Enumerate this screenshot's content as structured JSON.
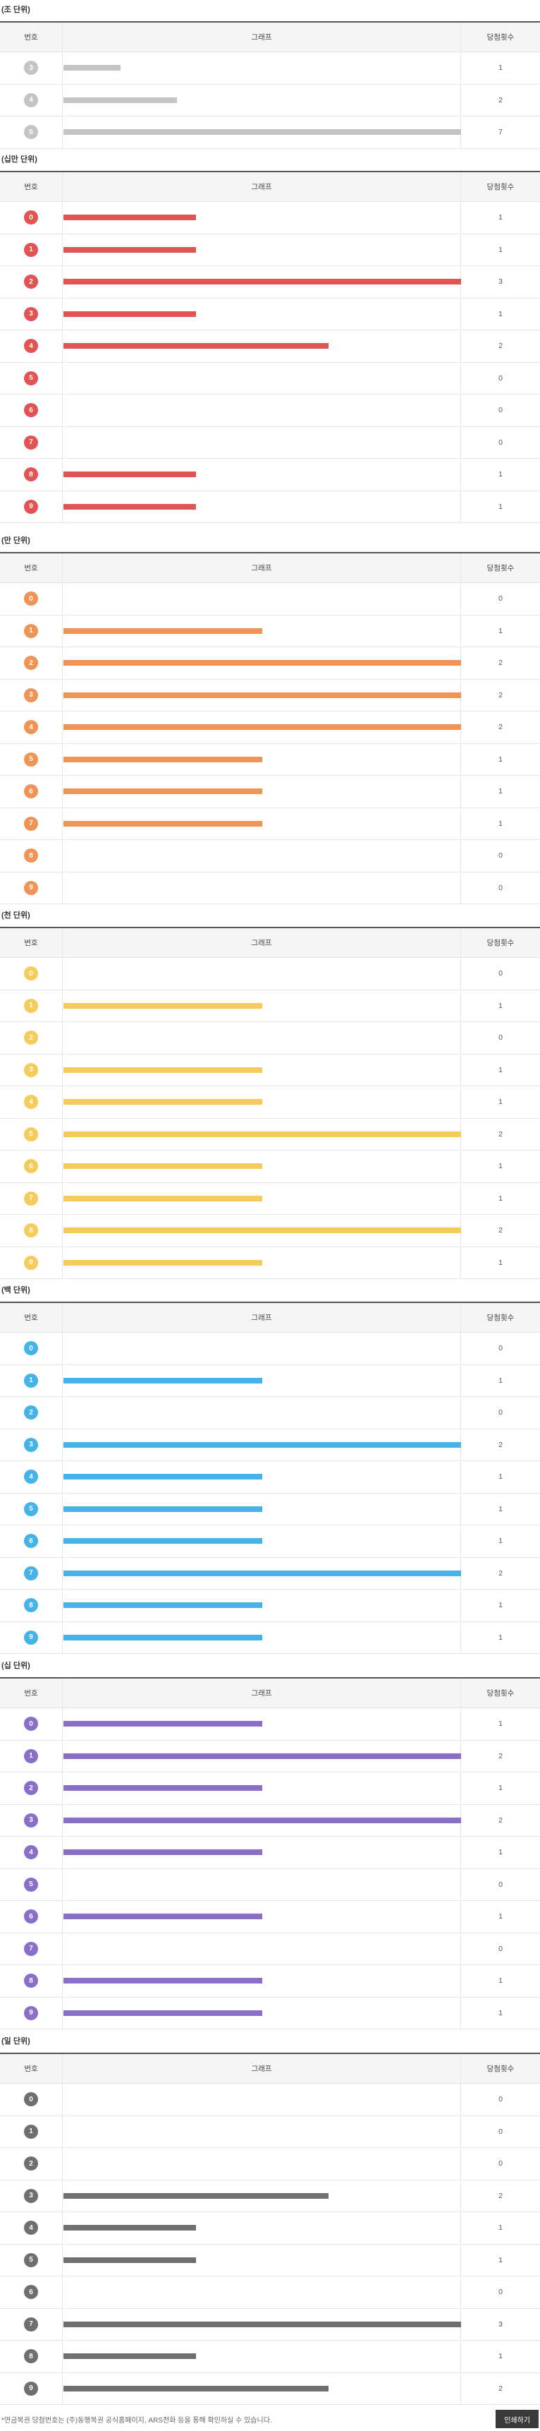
{
  "table_header": {
    "number": "번호",
    "graph": "그래프",
    "count": "당첨횟수"
  },
  "footer": {
    "note": "*연금복권 당첨번호는 (주)동행복권 공식홈페이지, ARS전화 등을 통해 확인하실 수 있습니다.",
    "print_label": "인쇄하기"
  },
  "chart_data": [
    {
      "type": "bar",
      "title": "(조 단위)",
      "color": "#c4c4c4",
      "categories": [
        "3",
        "4",
        "5"
      ],
      "values": [
        1,
        2,
        7
      ],
      "ylim": [
        0,
        7
      ]
    },
    {
      "type": "bar",
      "title": "(십만 단위)",
      "color": "#e05454",
      "categories": [
        "0",
        "1",
        "2",
        "3",
        "4",
        "5",
        "6",
        "7",
        "8",
        "9"
      ],
      "values": [
        1,
        1,
        3,
        1,
        2,
        0,
        0,
        0,
        1,
        1
      ],
      "ylim": [
        0,
        3
      ]
    },
    {
      "type": "bar",
      "title": "(만 단위)",
      "color": "#ef9455",
      "categories": [
        "0",
        "1",
        "2",
        "3",
        "4",
        "5",
        "6",
        "7",
        "8",
        "9"
      ],
      "values": [
        0,
        1,
        2,
        2,
        2,
        1,
        1,
        1,
        0,
        0
      ],
      "ylim": [
        0,
        2
      ]
    },
    {
      "type": "bar",
      "title": "(천 단위)",
      "color": "#f5cc5b",
      "categories": [
        "0",
        "1",
        "2",
        "3",
        "4",
        "5",
        "6",
        "7",
        "8",
        "9"
      ],
      "values": [
        0,
        1,
        0,
        1,
        1,
        2,
        1,
        1,
        2,
        1
      ],
      "ylim": [
        0,
        2
      ]
    },
    {
      "type": "bar",
      "title": "(백 단위)",
      "color": "#45b3e7",
      "categories": [
        "0",
        "1",
        "2",
        "3",
        "4",
        "5",
        "6",
        "7",
        "8",
        "9"
      ],
      "values": [
        0,
        1,
        0,
        2,
        1,
        1,
        1,
        2,
        1,
        1
      ],
      "ylim": [
        0,
        2
      ]
    },
    {
      "type": "bar",
      "title": "(십 단위)",
      "color": "#8a6fc9",
      "categories": [
        "0",
        "1",
        "2",
        "3",
        "4",
        "5",
        "6",
        "7",
        "8",
        "9"
      ],
      "values": [
        1,
        2,
        1,
        2,
        1,
        0,
        1,
        0,
        1,
        1
      ],
      "ylim": [
        0,
        2
      ]
    },
    {
      "type": "bar",
      "title": "(일 단위)",
      "color": "#6f6f6f",
      "categories": [
        "0",
        "1",
        "2",
        "3",
        "4",
        "5",
        "6",
        "7",
        "8",
        "9"
      ],
      "values": [
        0,
        0,
        0,
        2,
        1,
        1,
        0,
        3,
        1,
        2
      ],
      "ylim": [
        0,
        3
      ]
    }
  ]
}
